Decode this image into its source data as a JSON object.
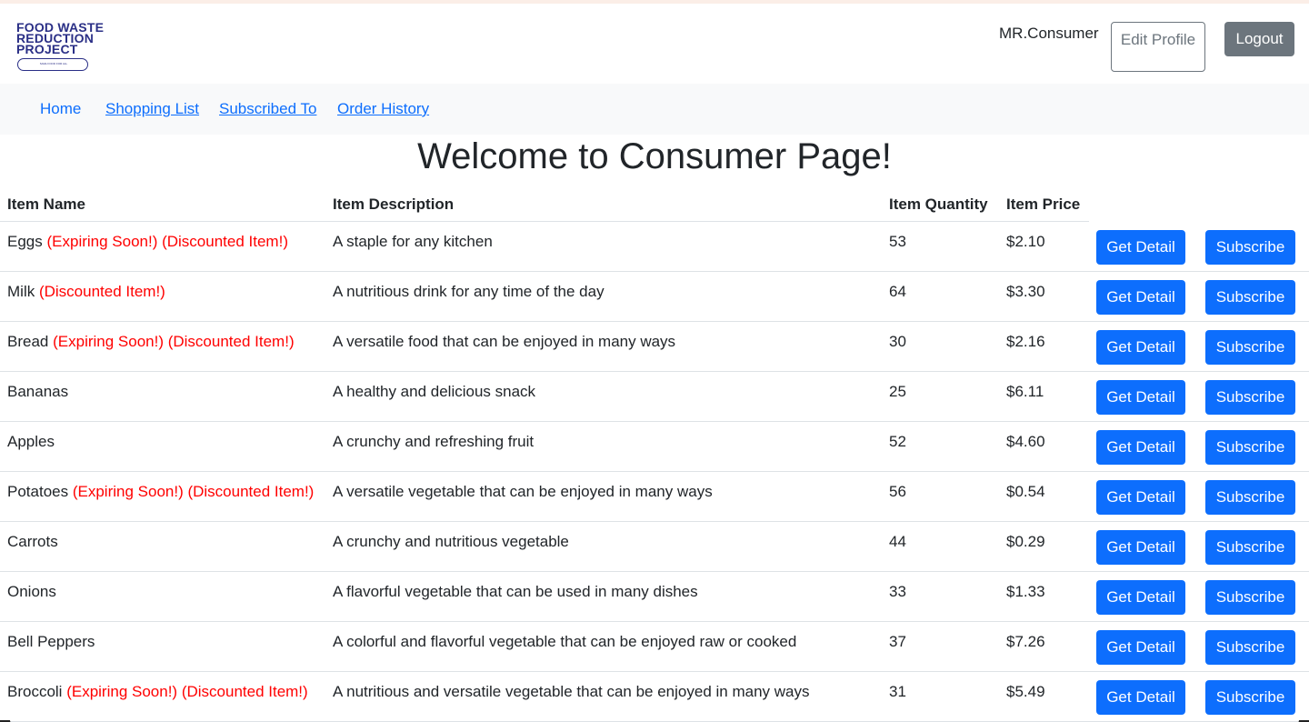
{
  "header": {
    "logo_lines": [
      "FOOD WASTE",
      "REDUCTION",
      "PROJECT"
    ],
    "logo_tagline": "SAVE FOOD FOR ALL",
    "username": "MR.Consumer",
    "edit_profile_label": "Edit Profile",
    "logout_label": "Logout"
  },
  "nav": {
    "items": [
      {
        "label": "Home"
      },
      {
        "label": "Shopping List"
      },
      {
        "label": "Subscribed To"
      },
      {
        "label": "Order History"
      }
    ]
  },
  "page": {
    "title": "Welcome to Consumer Page!"
  },
  "colors": {
    "primary": "#0d6efd",
    "secondary": "#6c757d",
    "danger_text": "#ff0000",
    "navbar_bg": "#f8f9fa"
  },
  "table": {
    "headers": [
      "Item Name",
      "Item Description",
      "Item Quantity",
      "Item Price"
    ],
    "detail_label": "Get Detail",
    "subscribe_label": "Subscribe",
    "rows": [
      {
        "name": "Eggs",
        "tags": "(Expiring Soon!) (Discounted Item!)",
        "description": "A staple for any kitchen",
        "quantity": "53",
        "price": "$2.10"
      },
      {
        "name": "Milk",
        "tags": "(Discounted Item!)",
        "description": "A nutritious drink for any time of the day",
        "quantity": "64",
        "price": "$3.30"
      },
      {
        "name": "Bread",
        "tags": "(Expiring Soon!) (Discounted Item!)",
        "description": "A versatile food that can be enjoyed in many ways",
        "quantity": "30",
        "price": "$2.16"
      },
      {
        "name": "Bananas",
        "tags": "",
        "description": "A healthy and delicious snack",
        "quantity": "25",
        "price": "$6.11"
      },
      {
        "name": "Apples",
        "tags": "",
        "description": "A crunchy and refreshing fruit",
        "quantity": "52",
        "price": "$4.60"
      },
      {
        "name": "Potatoes",
        "tags": "(Expiring Soon!) (Discounted Item!)",
        "description": "A versatile vegetable that can be enjoyed in many ways",
        "quantity": "56",
        "price": "$0.54"
      },
      {
        "name": "Carrots",
        "tags": "",
        "description": "A crunchy and nutritious vegetable",
        "quantity": "44",
        "price": "$0.29"
      },
      {
        "name": "Onions",
        "tags": "",
        "description": "A flavorful vegetable that can be used in many dishes",
        "quantity": "33",
        "price": "$1.33"
      },
      {
        "name": "Bell Peppers",
        "tags": "",
        "description": "A colorful and flavorful vegetable that can be enjoyed raw or cooked",
        "quantity": "37",
        "price": "$7.26"
      },
      {
        "name": "Broccoli",
        "tags": "(Expiring Soon!) (Discounted Item!)",
        "description": "A nutritious and versatile vegetable that can be enjoyed in many ways",
        "quantity": "31",
        "price": "$5.49"
      }
    ]
  }
}
